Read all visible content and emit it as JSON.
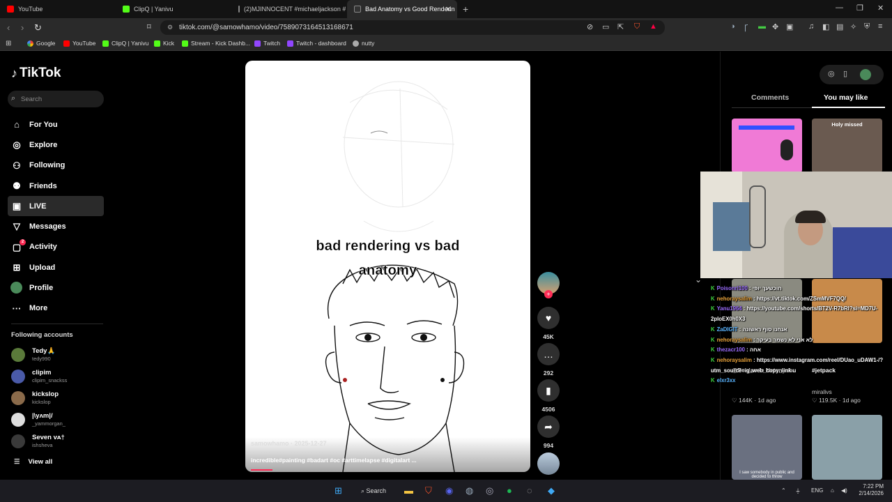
{
  "browser": {
    "tabs": [
      {
        "title": "YouTube",
        "color": "#ff0000"
      },
      {
        "title": "ClipQ | Yanivu",
        "color": "#53fc18"
      },
      {
        "title": "(2)MJINNOCENT #michaeljackson #",
        "color": "#ffffff"
      },
      {
        "title": "Bad Anatomy vs Good Renderin",
        "color": "#ffffff"
      }
    ],
    "url": "tiktok.com/@samowhamo/video/7589073164513168671",
    "bookmarks": [
      "Google",
      "YouTube",
      "ClipQ | Yanivu",
      "Kick",
      "Stream - Kick Dashb...",
      "Twitch",
      "Twitch - dashboard",
      "nutty"
    ]
  },
  "tiktok": {
    "logo": "TikTok",
    "search_placeholder": "Search",
    "nav": [
      "For You",
      "Explore",
      "Following",
      "Friends",
      "LIVE",
      "Messages",
      "Activity",
      "Upload",
      "Profile",
      "More"
    ],
    "nav_icons": [
      "home-icon",
      "compass-icon",
      "following-icon",
      "friends-icon",
      "live-icon",
      "messages-icon",
      "activity-icon",
      "upload-icon",
      "profile-icon",
      "more-icon"
    ],
    "activity_badge": "2",
    "following_heading": "Following accounts",
    "accounts": [
      {
        "name": "Tedy🙏",
        "handle": "tedy990",
        "color": "#5a7a3a"
      },
      {
        "name": "clipim",
        "handle": "clipim_snackss",
        "color": "#4a5aa8"
      },
      {
        "name": "kickslop",
        "handle": "kickslop",
        "color": "#8a6a4a"
      },
      {
        "name": "|\\yʌm|/",
        "handle": "_yammorgan_",
        "color": "#dddddd"
      },
      {
        "name": "Seven ᴠᴀ†",
        "handle": "ishsheva",
        "color": "#3a3a3a"
      }
    ],
    "view_all": "View all"
  },
  "video": {
    "caption_line1": "bad rendering vs bad",
    "caption_line2": "anatomy",
    "author": "samowhamo · 2025-12-27",
    "description": "incredible#painting #badart #oc #arttimelapse #digitalart ...",
    "progress": 0.08,
    "likes": "45K",
    "comments": "292",
    "saves": "4506",
    "shares": "994"
  },
  "right_panel": {
    "tabs": [
      "Comments",
      "You may like"
    ],
    "active_tab": "You may like",
    "thumb2_caption": "Holy missed",
    "item_left": {
      "title": "@Benjamin Netanyahu",
      "likes": "144K",
      "age": "1d ago"
    },
    "item_right": {
      "title": "#jetpack",
      "author": "miralivs",
      "likes": "119.5K",
      "age": "1d ago"
    },
    "thumb5_caption": "I saw somebody in public and decided to throw"
  },
  "chat": [
    {
      "user": "Poisonri100",
      "text": "חוכשעך יופי"
    },
    {
      "user": "nehoraysalim",
      "text": "https://vt.tiktok.com/ZSmMVF7QQ/"
    },
    {
      "user": "Yanu1964",
      "text": "https://youtube.com/shorts/BT2V-R7bRI?si=MD7U-2ploEX0h0X3"
    },
    {
      "user": "ZaDIGIT",
      "text": "אנחנו סוף ראשונה"
    },
    {
      "user": "nehoraysalim",
      "text": "לא אני לא נשמר בעיקר"
    },
    {
      "user": "thezacr100",
      "text": "אחה"
    },
    {
      "user": "nehoraysalim",
      "text": "https://www.instagram.com/reel/DUao_uDAW1-/?utm_source=ig_web_copy_link"
    },
    {
      "user": "elxr3xx",
      "text": ""
    }
  ],
  "taskbar": {
    "search": "Search",
    "lang": "ENG",
    "time": "7:22 PM",
    "date": "2/14/2026"
  }
}
